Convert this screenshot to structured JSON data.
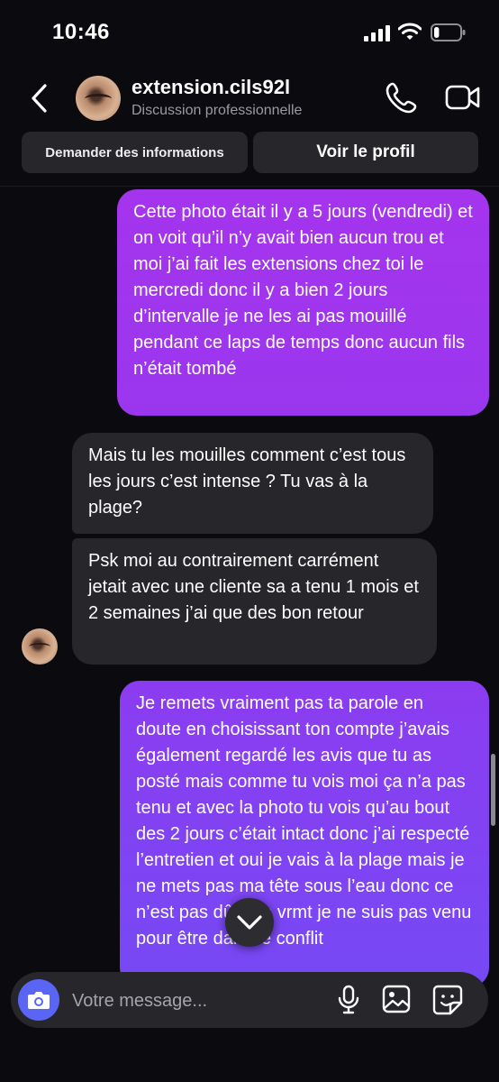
{
  "status_bar": {
    "time": "10:46",
    "battery_level": 0.2
  },
  "header": {
    "username": "extension.cils92l",
    "subtitle": "Discussion professionnelle"
  },
  "actions": {
    "info_label": "Demander des informations",
    "profile_label": "Voir le profil"
  },
  "messages": [
    {
      "direction": "outgoing",
      "text": "Cette photo était il y a 5 jours (vendredi) et on voit qu’il n’y avait bien aucun trou et moi j’ai fait les extensions chez toi le mercredi donc il y a bien 2 jours d’intervalle je ne les ai pas mouillé pendant ce laps de temps donc aucun fils n’était tombé"
    },
    {
      "direction": "incoming",
      "text": "Mais tu les mouilles comment c’est tous les jours c’est intense ? Tu vas à la plage?"
    },
    {
      "direction": "incoming",
      "text": "Psk moi au contrairement carrément jetait avec une cliente sa a tenu 1 mois et 2 semaines j’ai que des bon retour"
    },
    {
      "direction": "outgoing",
      "text": "Je remets vraiment pas ta parole en doute en choisissant ton compte j’avais également regardé les avis que tu as posté mais comme tu vois moi ça n’a pas tenu et avec la photo tu vois qu’au bout des 2 jours c’était intact donc j’ai respecté l’entretien et oui je vais à la plage mais je ne mets pas ma tête sous l’eau donc ce n’est pas dû à ça vrmt je ne suis pas venu pour être dans le conflit"
    }
  ],
  "composer": {
    "placeholder": "Votre message..."
  },
  "icons": {
    "back": "chevron-left-icon",
    "phone": "phone-icon",
    "video": "video-camera-icon",
    "camera": "camera-icon",
    "mic": "microphone-icon",
    "gallery": "image-icon",
    "sticker": "sticker-icon",
    "scroll": "chevron-down-icon"
  },
  "colors": {
    "outgoing_top": "#a534ed",
    "outgoing_bottom": "#7649f5",
    "incoming": "#26262b",
    "camera_button": "#5a64f5",
    "background": "#0b0b0f"
  }
}
